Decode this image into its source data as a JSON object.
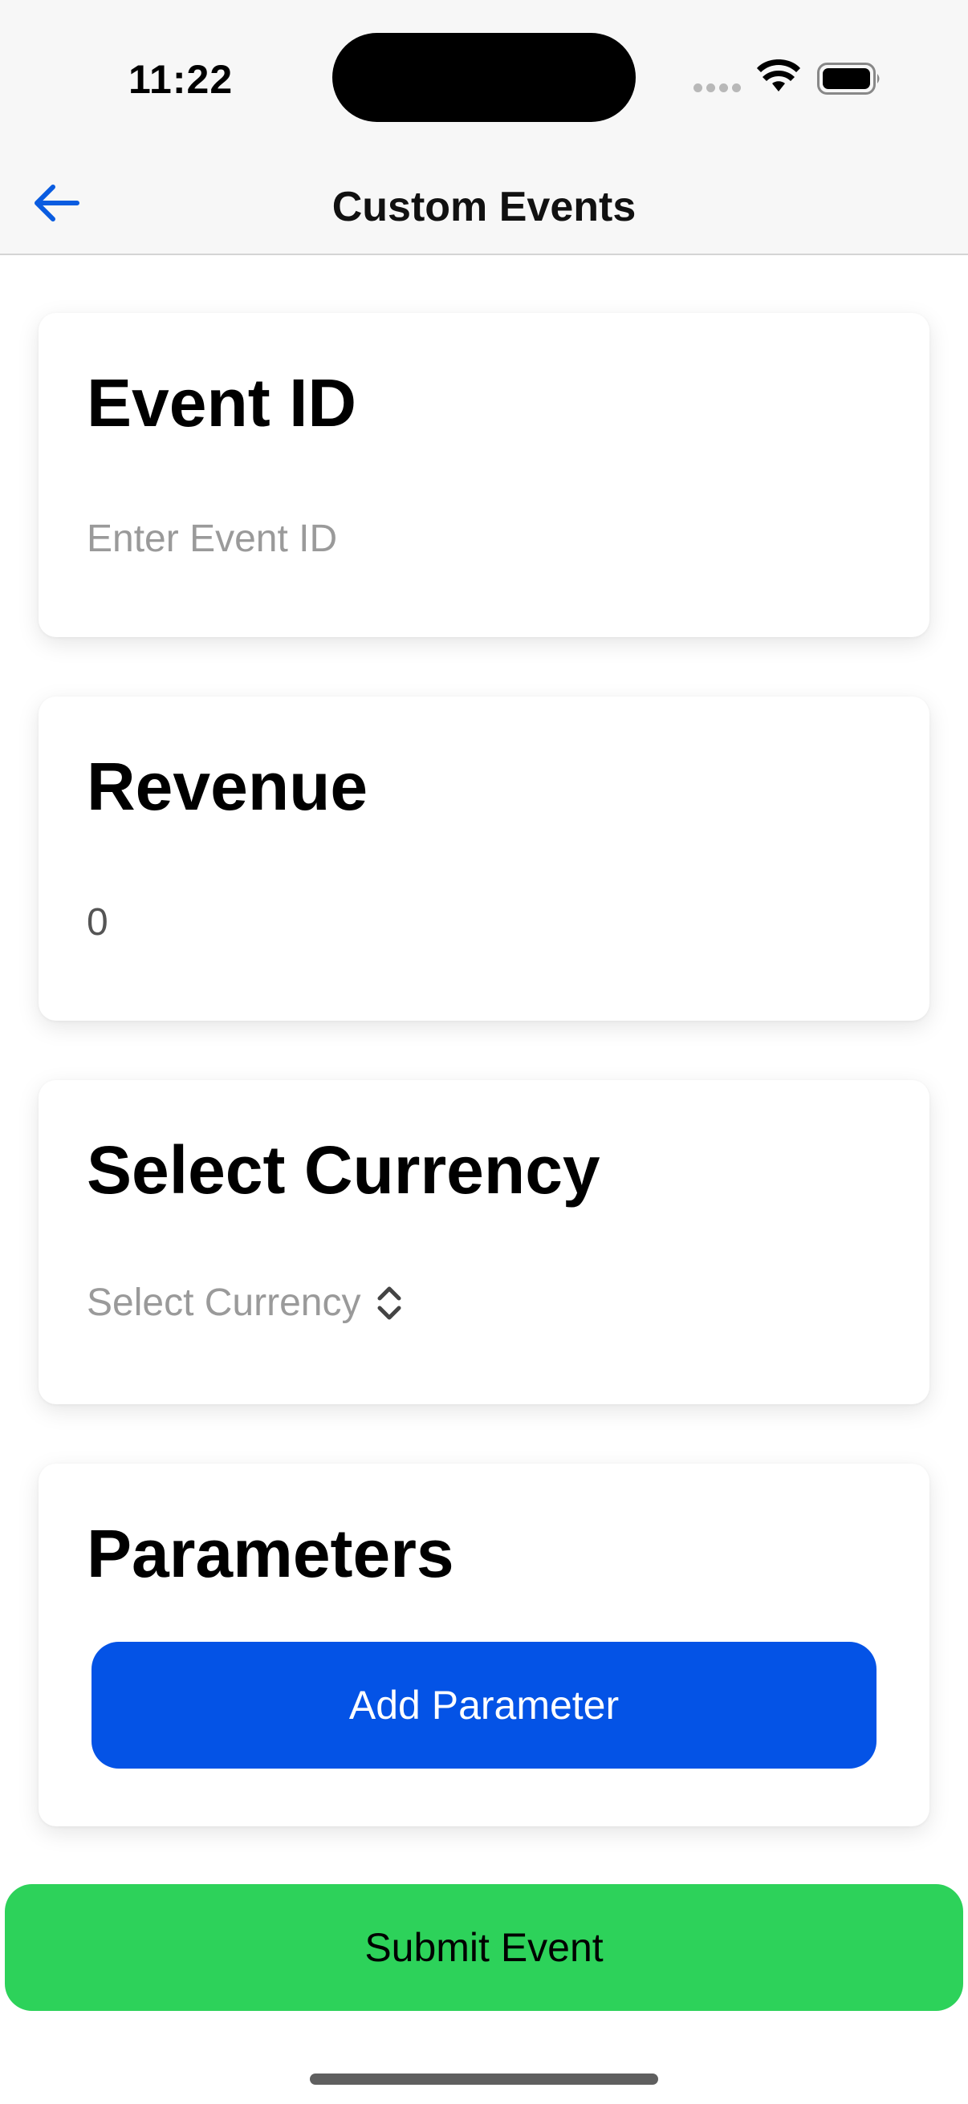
{
  "status_bar": {
    "time": "11:22",
    "icons": [
      "signal-dots-icon",
      "wifi-icon",
      "battery-icon"
    ]
  },
  "nav": {
    "title": "Custom Events",
    "back_icon": "arrow-left-icon"
  },
  "form": {
    "event_id": {
      "label": "Event ID",
      "placeholder": "Enter Event ID",
      "value": ""
    },
    "revenue": {
      "label": "Revenue",
      "value": "0"
    },
    "currency": {
      "label": "Select Currency",
      "selected": "Select Currency",
      "icon": "chevron-up-down-icon"
    },
    "parameters": {
      "label": "Parameters",
      "add_button": "Add Parameter"
    }
  },
  "submit_label": "Submit Event",
  "colors": {
    "accent_blue": "#0453e6",
    "submit_green": "#2dd25a",
    "back_arrow": "#0a5ce0",
    "bar_background": "#f7f7f7"
  }
}
